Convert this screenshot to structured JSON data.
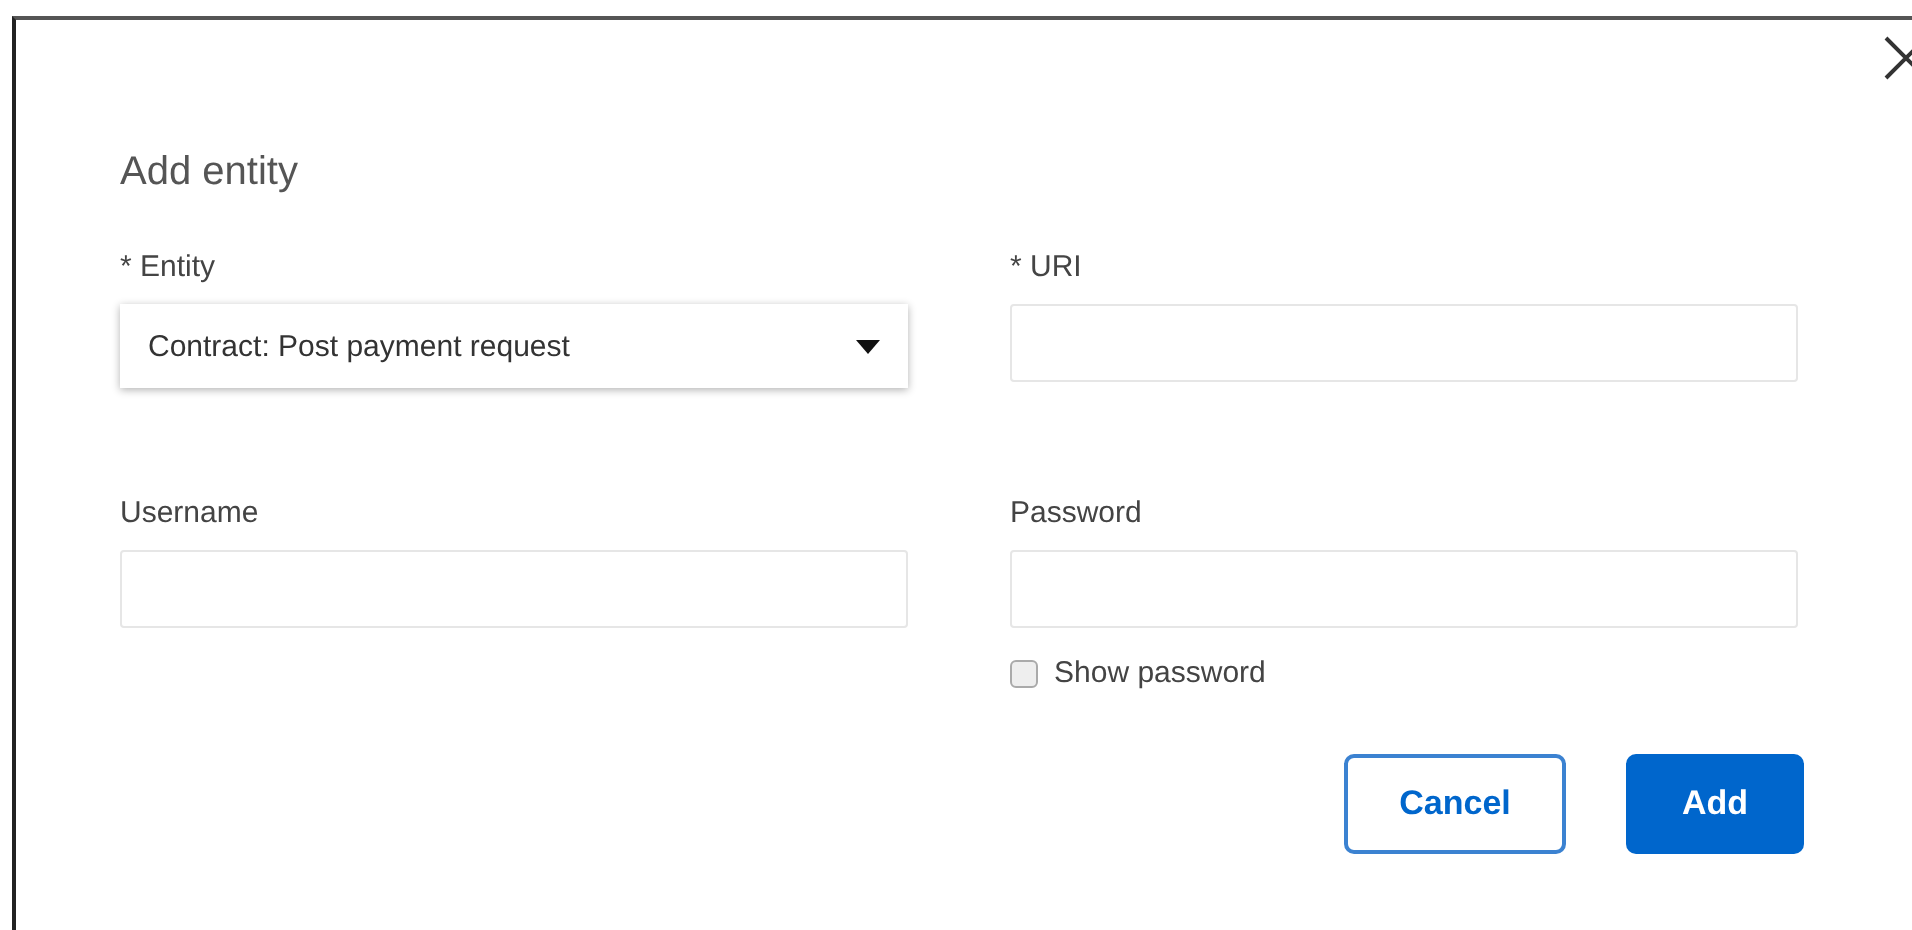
{
  "dialog": {
    "title": "Add entity"
  },
  "fields": [
    {
      "label": "* Entity",
      "kind": "select",
      "value": "Contract: Post payment request"
    },
    {
      "label": "* URI",
      "kind": "text"
    },
    {
      "label": "Username",
      "kind": "text"
    },
    {
      "label": "Password",
      "kind": "password"
    }
  ],
  "show_password": {
    "label": "Show password",
    "checked": false
  },
  "buttons": [
    {
      "label": "Cancel",
      "kind": "secondary"
    },
    {
      "label": "Add",
      "kind": "primary"
    }
  ]
}
